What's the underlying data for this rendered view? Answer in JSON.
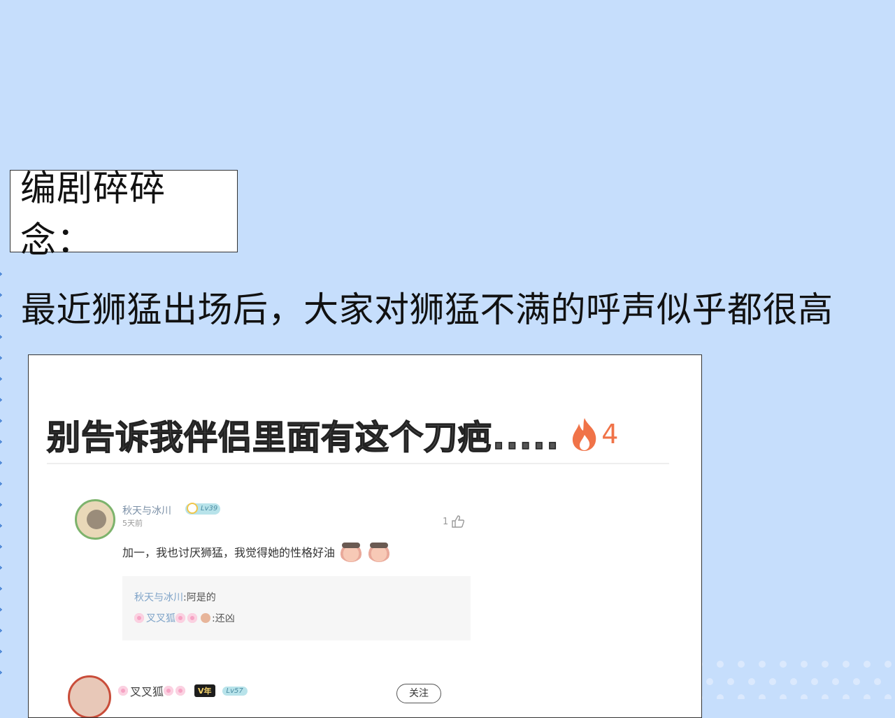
{
  "heading": {
    "label": "编剧碎碎念："
  },
  "intro": {
    "text": "最近狮猛出场后，大家对狮猛不满的呼声似乎都很高"
  },
  "screenshot": {
    "post": {
      "title": "别告诉我伴侣里面有这个刀疤.....",
      "hot_count": "4"
    },
    "comments": [
      {
        "username": "秋天与冰川",
        "level": "Lv39",
        "time": "5天前",
        "likes": "1",
        "text": "加一，我也讨厌狮猛，我觉得她的性格好油",
        "replies": [
          {
            "name": "秋天与冰川",
            "text": ":阿是的"
          },
          {
            "name": "叉叉狐",
            "text": ":还凶"
          }
        ]
      },
      {
        "username": "叉叉狐",
        "vip": "V年",
        "level": "Lv57",
        "follow": "关注"
      }
    ]
  },
  "colors": {
    "background": "#c6defc",
    "hot": "#f07348",
    "level_badge": "#b8e3ea"
  },
  "icons": [
    "fire-icon",
    "thumb-up-icon",
    "avatar",
    "emoji-icon",
    "flower-icon"
  ]
}
